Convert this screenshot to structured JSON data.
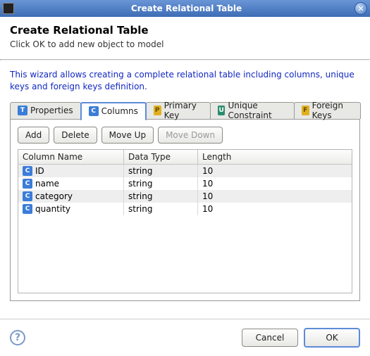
{
  "window": {
    "title": "Create Relational Table"
  },
  "header": {
    "title": "Create Relational Table",
    "subtitle": "Click OK to add new object to model"
  },
  "wizard_desc": "This wizard allows creating a complete relational table including columns, unique keys and foreign keys definition.",
  "tabs": {
    "properties": {
      "label": "Properties",
      "icon": "T"
    },
    "columns": {
      "label": "Columns",
      "icon": "C"
    },
    "primary": {
      "label": "Primary Key",
      "icon": "P"
    },
    "unique": {
      "label": "Unique Constraint",
      "icon": "U"
    },
    "foreign": {
      "label": "Foreign Keys",
      "icon": "F"
    }
  },
  "toolbar": {
    "add": "Add",
    "delete": "Delete",
    "move_up": "Move Up",
    "move_down": "Move Down"
  },
  "table": {
    "headers": {
      "name": "Column Name",
      "type": "Data Type",
      "length": "Length"
    },
    "rows": [
      {
        "name": "ID",
        "type": "string",
        "length": "10"
      },
      {
        "name": "name",
        "type": "string",
        "length": "10"
      },
      {
        "name": "category",
        "type": "string",
        "length": "10"
      },
      {
        "name": "quantity",
        "type": "string",
        "length": "10"
      }
    ]
  },
  "footer": {
    "cancel": "Cancel",
    "ok": "OK"
  }
}
